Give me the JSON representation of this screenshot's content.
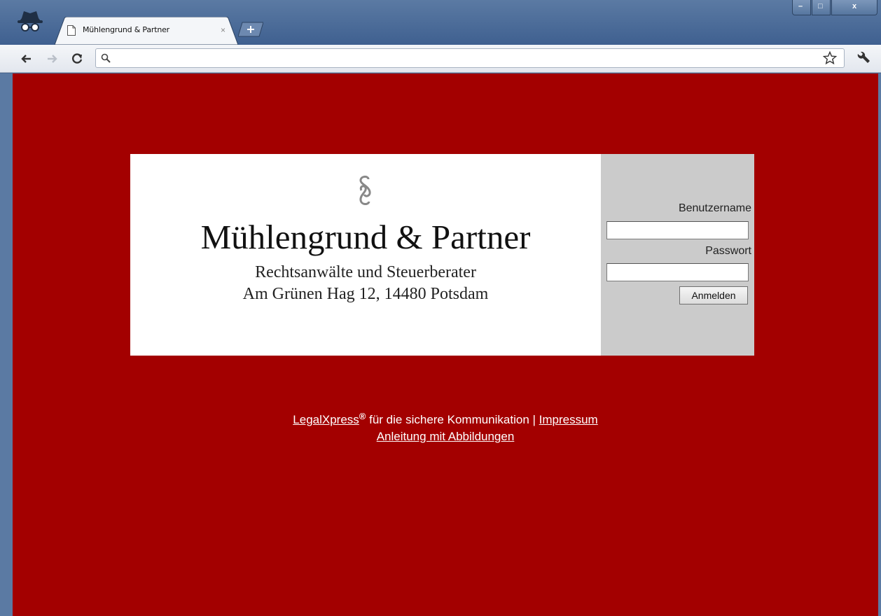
{
  "browser": {
    "tab_title": "Mühlengrund & Partner",
    "tab_close": "×",
    "address_value": "",
    "window_controls": {
      "minimize": "–",
      "maximize": "□",
      "close": "x"
    }
  },
  "banner": {
    "firm_name": "Mühlengrund & Partner",
    "subtitle": "Rechtsanwälte und Steuerberater",
    "address": "Am Grünen Hag 12, 14480 Potsdam"
  },
  "login": {
    "username_label": "Benutzername",
    "username_value": "",
    "password_label": "Passwort",
    "password_value": "",
    "submit_label": "Anmelden"
  },
  "footer": {
    "legalxpress_link": "LegalXpress",
    "registered_mark": "®",
    "tagline": " für die sichere Kommunikation | ",
    "impressum_link": "Impressum",
    "guide_link": "Anleitung mit Abbildungen"
  },
  "colors": {
    "page_background": "#a30000",
    "login_panel": "#cbcbcb",
    "chrome_frame": "#5b7aa3"
  }
}
